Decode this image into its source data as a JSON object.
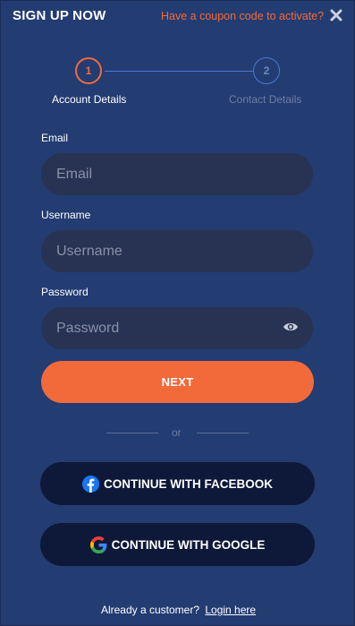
{
  "header": {
    "title": "SIGN UP NOW",
    "coupon_link": "Have a coupon code to activate?",
    "close_icon": "close-icon"
  },
  "stepper": {
    "steps": [
      {
        "number": "1",
        "label": "Account Details",
        "state": "active"
      },
      {
        "number": "2",
        "label": "Contact Details",
        "state": "inactive"
      }
    ]
  },
  "form": {
    "email": {
      "label": "Email",
      "placeholder": "Email",
      "value": ""
    },
    "username": {
      "label": "Username",
      "placeholder": "Username",
      "value": ""
    },
    "password": {
      "label": "Password",
      "placeholder": "Password",
      "value": "",
      "toggle_icon": "eye-icon"
    },
    "next_label": "NEXT"
  },
  "divider": {
    "text": "or"
  },
  "social": {
    "facebook": {
      "label": "CONTINUE WITH FACEBOOK",
      "icon": "facebook-icon"
    },
    "google": {
      "label": "CONTINUE WITH GOOGLE",
      "icon": "google-icon"
    }
  },
  "footer": {
    "prompt": "Already a customer?",
    "login_link": "Login here"
  },
  "colors": {
    "background": "#233c72",
    "accent": "#f26a3a",
    "input_bg": "#283253",
    "social_bg": "#0e1939"
  }
}
